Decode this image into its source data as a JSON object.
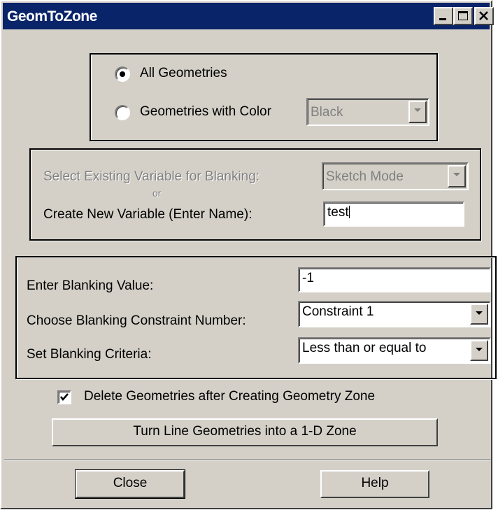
{
  "window": {
    "title": "GeomToZone"
  },
  "geometry_source": {
    "all_geometries_label": "All Geometries",
    "with_color_label": "Geometries with Color",
    "color_value": "Black",
    "selected": "All Geometries"
  },
  "blanking_variable": {
    "select_existing_label": "Select Existing Variable for Blanking:",
    "select_existing_value": "Sketch Mode",
    "or_label": "or",
    "create_new_label": "Create New Variable (Enter Name):",
    "create_new_value": "test"
  },
  "blanking": {
    "value_label": "Enter Blanking Value:",
    "value": "-1",
    "constraint_label": "Choose Blanking Constraint Number:",
    "constraint_value": "Constraint 1",
    "criteria_label": "Set Blanking Criteria:",
    "criteria_value": "Less than or equal to"
  },
  "delete_geometries": {
    "label": "Delete Geometries after Creating Geometry Zone",
    "checked": true
  },
  "actions": {
    "line_to_zone_label": "Turn Line Geometries into a 1-D Zone",
    "close_label": "Close",
    "help_label": "Help"
  }
}
